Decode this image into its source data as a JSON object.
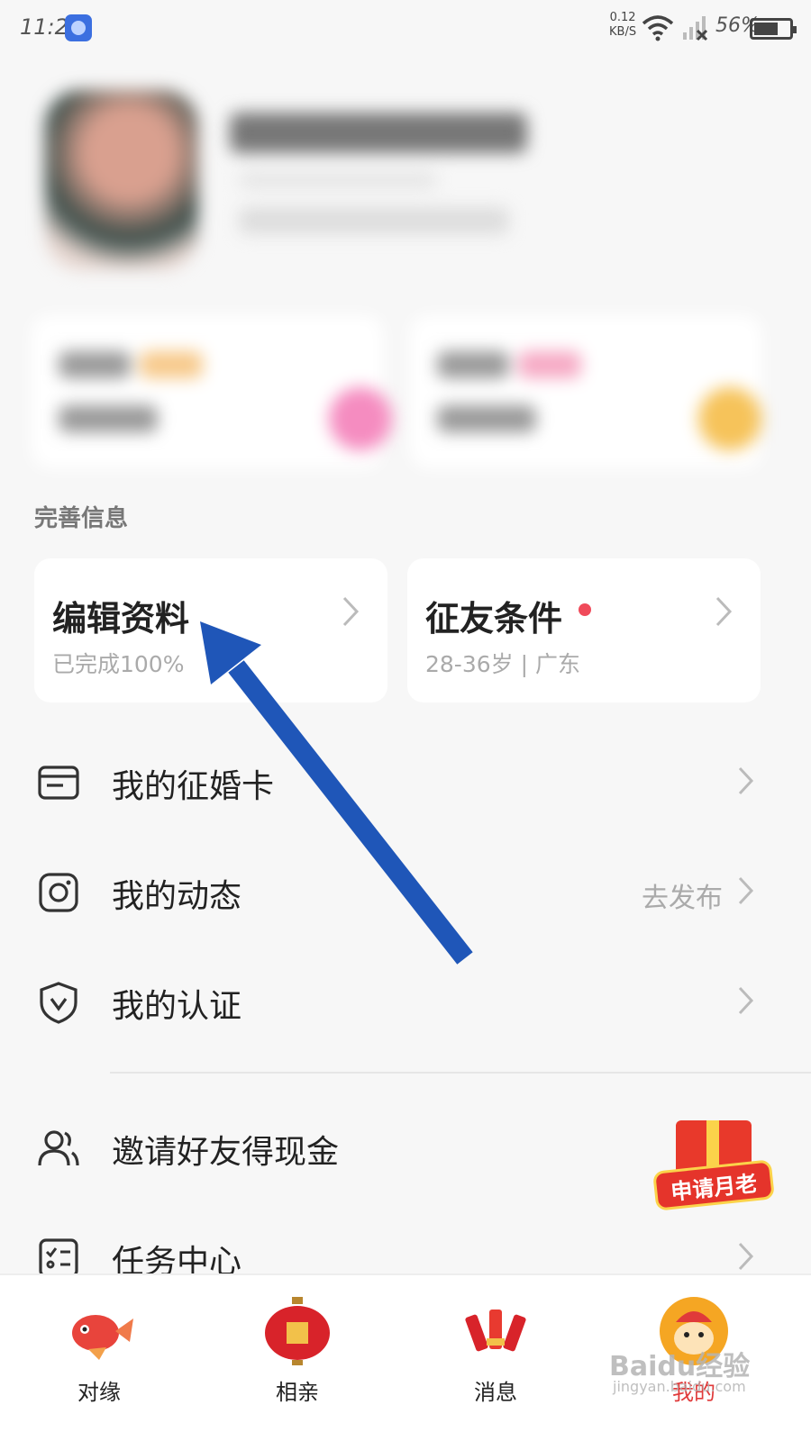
{
  "status_bar": {
    "time": "11:22",
    "speed_value": "0.12",
    "speed_unit": "KB/S",
    "battery": "56%"
  },
  "section": {
    "title": "完善信息"
  },
  "cards": {
    "edit_profile": {
      "title": "编辑资料",
      "subtitle": "已完成100%"
    },
    "criteria": {
      "title": "征友条件",
      "subtitle": "28-36岁 | 广东"
    }
  },
  "menu": {
    "marriage_card": "我的征婚卡",
    "moments": "我的动态",
    "moments_action": "去发布",
    "verification": "我的认证",
    "invite": "邀请好友得现金",
    "tasks": "任务中心"
  },
  "promo": {
    "label": "申请月老"
  },
  "nav": {
    "items": [
      {
        "label": "对缘"
      },
      {
        "label": "相亲"
      },
      {
        "label": "消息"
      },
      {
        "label": "我的"
      }
    ]
  },
  "watermark": {
    "text": "Baidu经验",
    "sub": "jingyan.baidu.com"
  },
  "colors": {
    "accent_red": "#f04a5a",
    "arrow_blue": "#1f56b8",
    "active_nav": "#e03a3a"
  }
}
